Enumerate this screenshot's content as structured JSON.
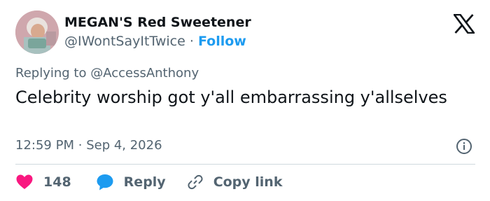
{
  "author": {
    "display_name": "MEGAN'S Red Sweetener",
    "handle": "@IWontSayItTwice",
    "separator": "·",
    "follow_label": "Follow"
  },
  "reply_context": {
    "prefix": "Replying to",
    "mention": "@AccessAnthony"
  },
  "tweet": {
    "text": "Celebrity worship got y'all embarrassing y'allselves"
  },
  "meta": {
    "time": "12:59 PM",
    "separator": "·",
    "date": "Sep 4, 2026"
  },
  "actions": {
    "like_count": "148",
    "reply_label": "Reply",
    "copy_link_label": "Copy link"
  },
  "colors": {
    "accent": "#1d9bf0",
    "like": "#f91880",
    "text": "#0f1419",
    "secondary": "#536471",
    "divider": "#cfd9de"
  },
  "icons": [
    "avatar",
    "x-logo-icon",
    "info-icon",
    "heart-icon",
    "reply-bubble-icon",
    "link-icon"
  ]
}
